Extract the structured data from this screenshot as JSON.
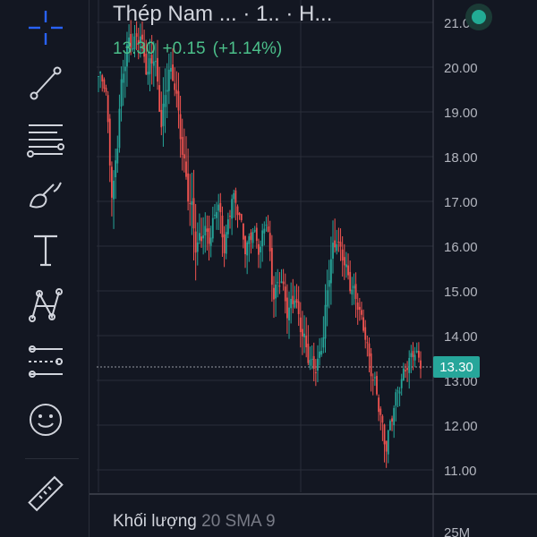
{
  "header": {
    "symbol_title": "Thép Nam ... · 1.. · H...",
    "last_price": "13.30",
    "change": "+0.15",
    "change_pct": "(+1.14%)",
    "live_status_color": "#22ab94"
  },
  "toolbar": {
    "tools": [
      "crosshair-icon",
      "trend-line-icon",
      "fib-retracement-icon",
      "brush-icon",
      "text-icon",
      "pattern-icon",
      "prediction-icon",
      "emoji-icon",
      "ruler-icon"
    ]
  },
  "volume_pane": {
    "title": "Khối lượng",
    "indicator": "20 SMA 9",
    "axis_label": "25M"
  },
  "colors": {
    "background": "#131722",
    "up": "#26a69a",
    "down": "#ef5350",
    "grid": "#2a2e39",
    "axis_text": "#b2b5be"
  },
  "chart_data": {
    "type": "candlestick",
    "y_ticks": [
      "21.00",
      "20.00",
      "19.00",
      "18.00",
      "17.00",
      "16.00",
      "15.00",
      "14.00",
      "13.00",
      "12.00",
      "11.00"
    ],
    "ylim": [
      10.5,
      21.3
    ],
    "last_price": 13.3,
    "close_trend": [
      19.8,
      19.5,
      17.0,
      19.2,
      20.3,
      20.6,
      20.8,
      19.7,
      20.3,
      18.8,
      19.9,
      19.5,
      18.2,
      17.0,
      15.8,
      16.5,
      16.2,
      16.9,
      16.0,
      17.2,
      16.7,
      15.9,
      16.5,
      15.8,
      16.6,
      15.0,
      15.3,
      14.4,
      15.0,
      14.1,
      13.4,
      13.3,
      13.9,
      15.4,
      16.2,
      15.8,
      15.0,
      14.7,
      14.2,
      13.1,
      12.4,
      11.6,
      12.3,
      12.8,
      13.4,
      13.7,
      13.3
    ],
    "range": [
      0.6,
      0.7,
      1.2,
      1.0,
      0.8,
      0.6,
      0.6,
      0.8,
      0.7,
      1.0,
      0.6,
      0.7,
      1.0,
      1.2,
      0.9,
      0.7,
      0.7,
      0.8,
      0.8,
      0.7,
      0.6,
      0.7,
      0.6,
      0.6,
      0.8,
      0.7,
      0.6,
      0.7,
      0.6,
      0.7,
      0.5,
      0.5,
      0.8,
      0.9,
      0.6,
      0.6,
      0.7,
      0.6,
      0.6,
      0.8,
      0.7,
      0.8,
      0.6,
      0.6,
      0.6,
      0.5,
      0.5
    ]
  }
}
